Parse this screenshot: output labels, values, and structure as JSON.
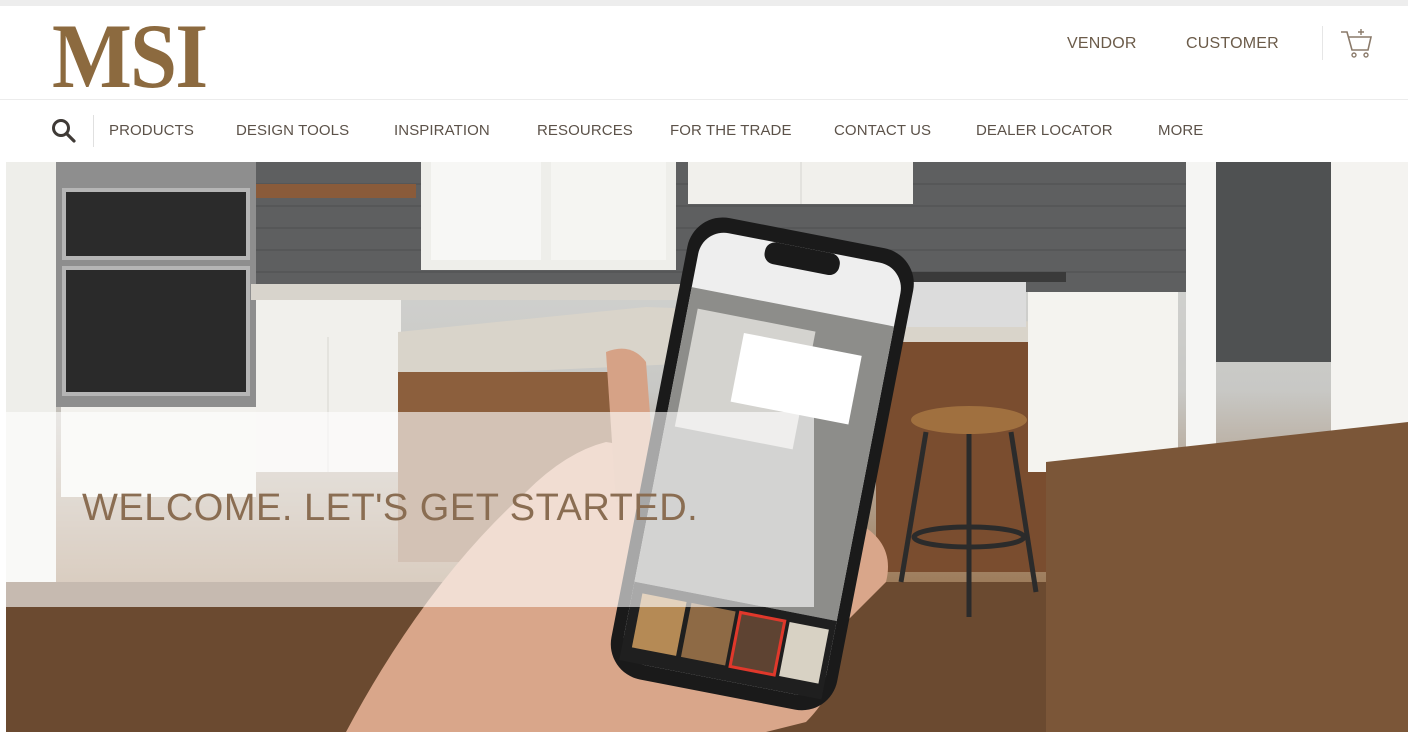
{
  "brand": {
    "logo_text": "MSI",
    "accent_color": "#8c6a3f"
  },
  "header": {
    "links": [
      "VENDOR",
      "CUSTOMER"
    ],
    "cart_icon": "cart-icon"
  },
  "nav": {
    "search_icon": "search-icon",
    "items": [
      "PRODUCTS",
      "DESIGN TOOLS",
      "INSPIRATION",
      "RESOURCES",
      "FOR THE TRADE",
      "CONTACT US",
      "DEALER LOCATOR",
      "MORE"
    ]
  },
  "hero": {
    "headline": "WELCOME. LET'S GET STARTED.",
    "image_subject": "kitchen with phone showing AR visualizer"
  }
}
